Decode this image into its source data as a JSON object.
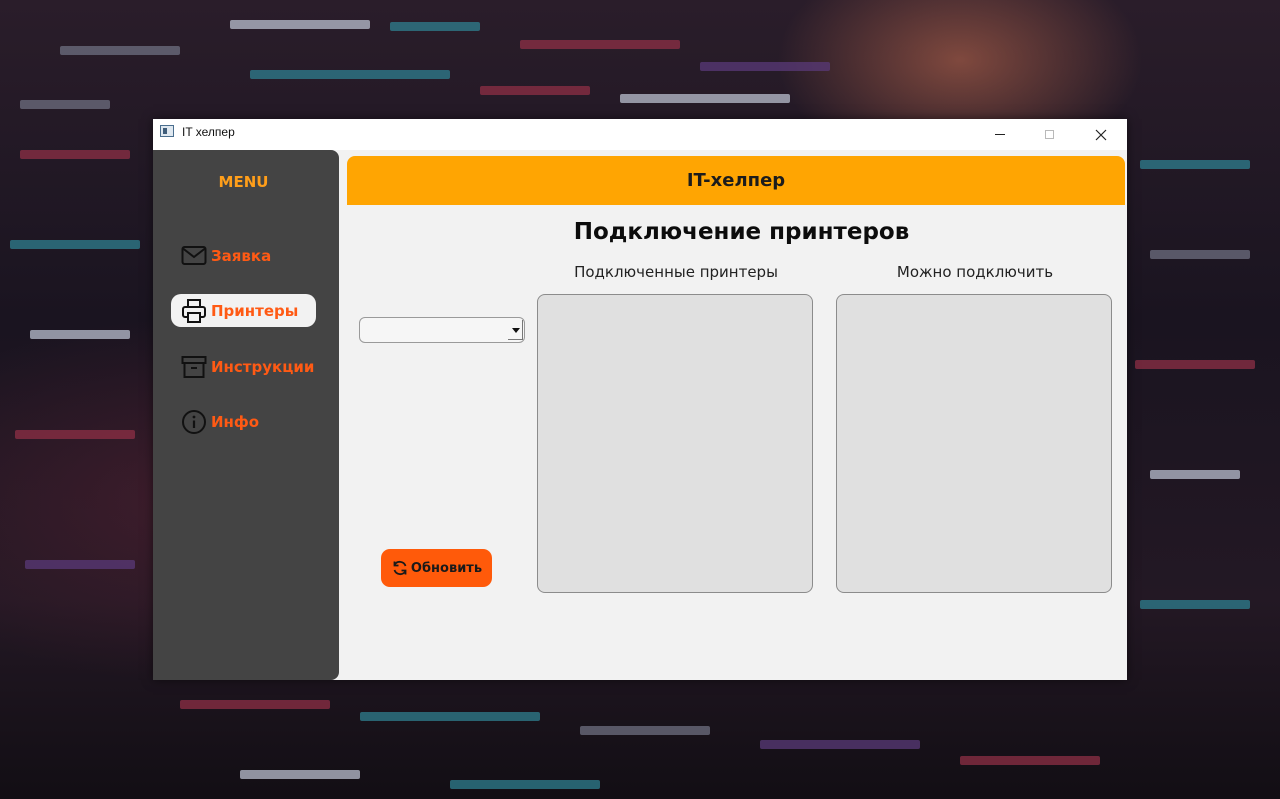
{
  "window": {
    "title": "IT хелпер"
  },
  "sidebar": {
    "menu_title": "MENU",
    "items": [
      {
        "label": "Заявка",
        "icon": "mail-icon",
        "active": false
      },
      {
        "label": "Принтеры",
        "icon": "printer-icon",
        "active": true
      },
      {
        "label": "Инструкции",
        "icon": "archive-icon",
        "active": false
      },
      {
        "label": "Инфо",
        "icon": "info-icon",
        "active": false
      }
    ]
  },
  "header": {
    "title": "IT-хелпер"
  },
  "main": {
    "page_title": "Подключение принтеров",
    "printer_select": {
      "value": ""
    },
    "connected_label": "Подключенные принтеры",
    "available_label": "Можно подключить",
    "connected_printers": [],
    "available_printers": [],
    "refresh_button": {
      "label": "Обновить",
      "icon": "refresh-icon"
    }
  },
  "colors": {
    "accent_orange": "#ffa502",
    "button_orange": "#ff5a0a",
    "nav_label": "#ff5a14",
    "sidebar_bg": "#444444"
  }
}
